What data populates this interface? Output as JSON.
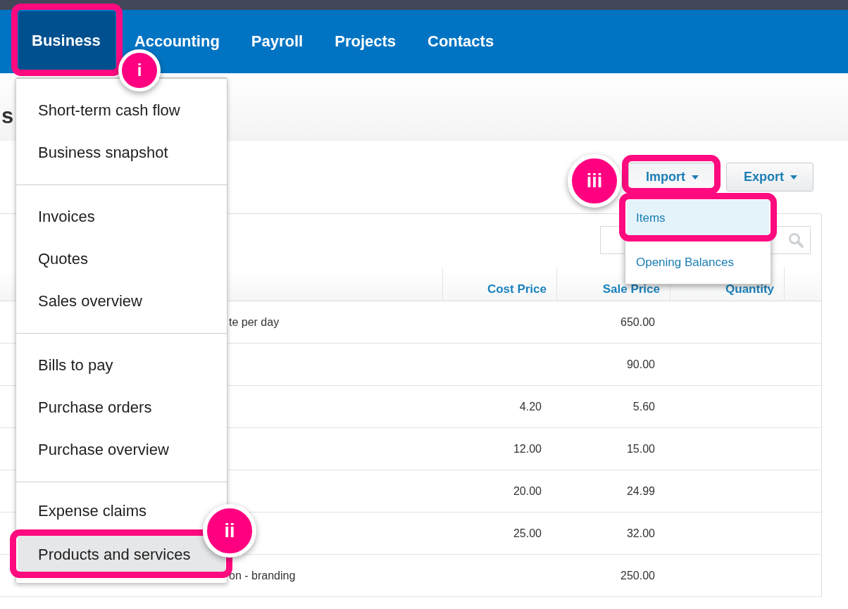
{
  "top_nav": [
    {
      "label": "Business",
      "selected": true,
      "highlighted": true,
      "annotation": "i"
    },
    {
      "label": "Accounting",
      "selected": false
    },
    {
      "label": "Payroll",
      "selected": false
    },
    {
      "label": "Projects",
      "selected": false
    },
    {
      "label": "Contacts",
      "selected": false
    }
  ],
  "business_menu": {
    "groups": [
      [
        {
          "label": "Short-term cash flow",
          "selected": false
        },
        {
          "label": "Business snapshot",
          "selected": false
        }
      ],
      [
        {
          "label": "Invoices",
          "selected": false
        },
        {
          "label": "Quotes",
          "selected": false
        },
        {
          "label": "Sales overview",
          "selected": false
        }
      ],
      [
        {
          "label": "Bills to pay",
          "selected": false
        },
        {
          "label": "Purchase orders",
          "selected": false
        },
        {
          "label": "Purchase overview",
          "selected": false
        }
      ],
      [
        {
          "label": "Expense claims",
          "selected": false
        },
        {
          "label": "Products and services",
          "selected": true,
          "highlighted": true,
          "annotation": "ii"
        }
      ]
    ]
  },
  "page_title": "s",
  "buttons": [
    {
      "label": "Import",
      "expanded": true,
      "highlighted": true,
      "annotation": "iii"
    },
    {
      "label": "Export",
      "expanded": false
    }
  ],
  "import_menu": {
    "items": [
      {
        "label": "Items",
        "selected": true,
        "highlighted": true
      },
      {
        "label": "Opening Balances",
        "selected": false
      }
    ]
  },
  "table": {
    "columns": [
      "Cost Price",
      "Sale Price",
      "Quantity"
    ],
    "rows": [
      {
        "description": "te per day",
        "sale_price": "650.00"
      },
      {
        "sale_price": "90.00"
      },
      {
        "cost_price": "4.20",
        "sale_price": "5.60"
      },
      {
        "cost_price": "12.00",
        "sale_price": "15.00"
      },
      {
        "cost_price": "20.00",
        "sale_price": "24.99"
      },
      {
        "cost_price": "25.00",
        "sale_price": "32.00"
      },
      {
        "description": "on - branding",
        "sale_price": "250.00"
      }
    ]
  }
}
